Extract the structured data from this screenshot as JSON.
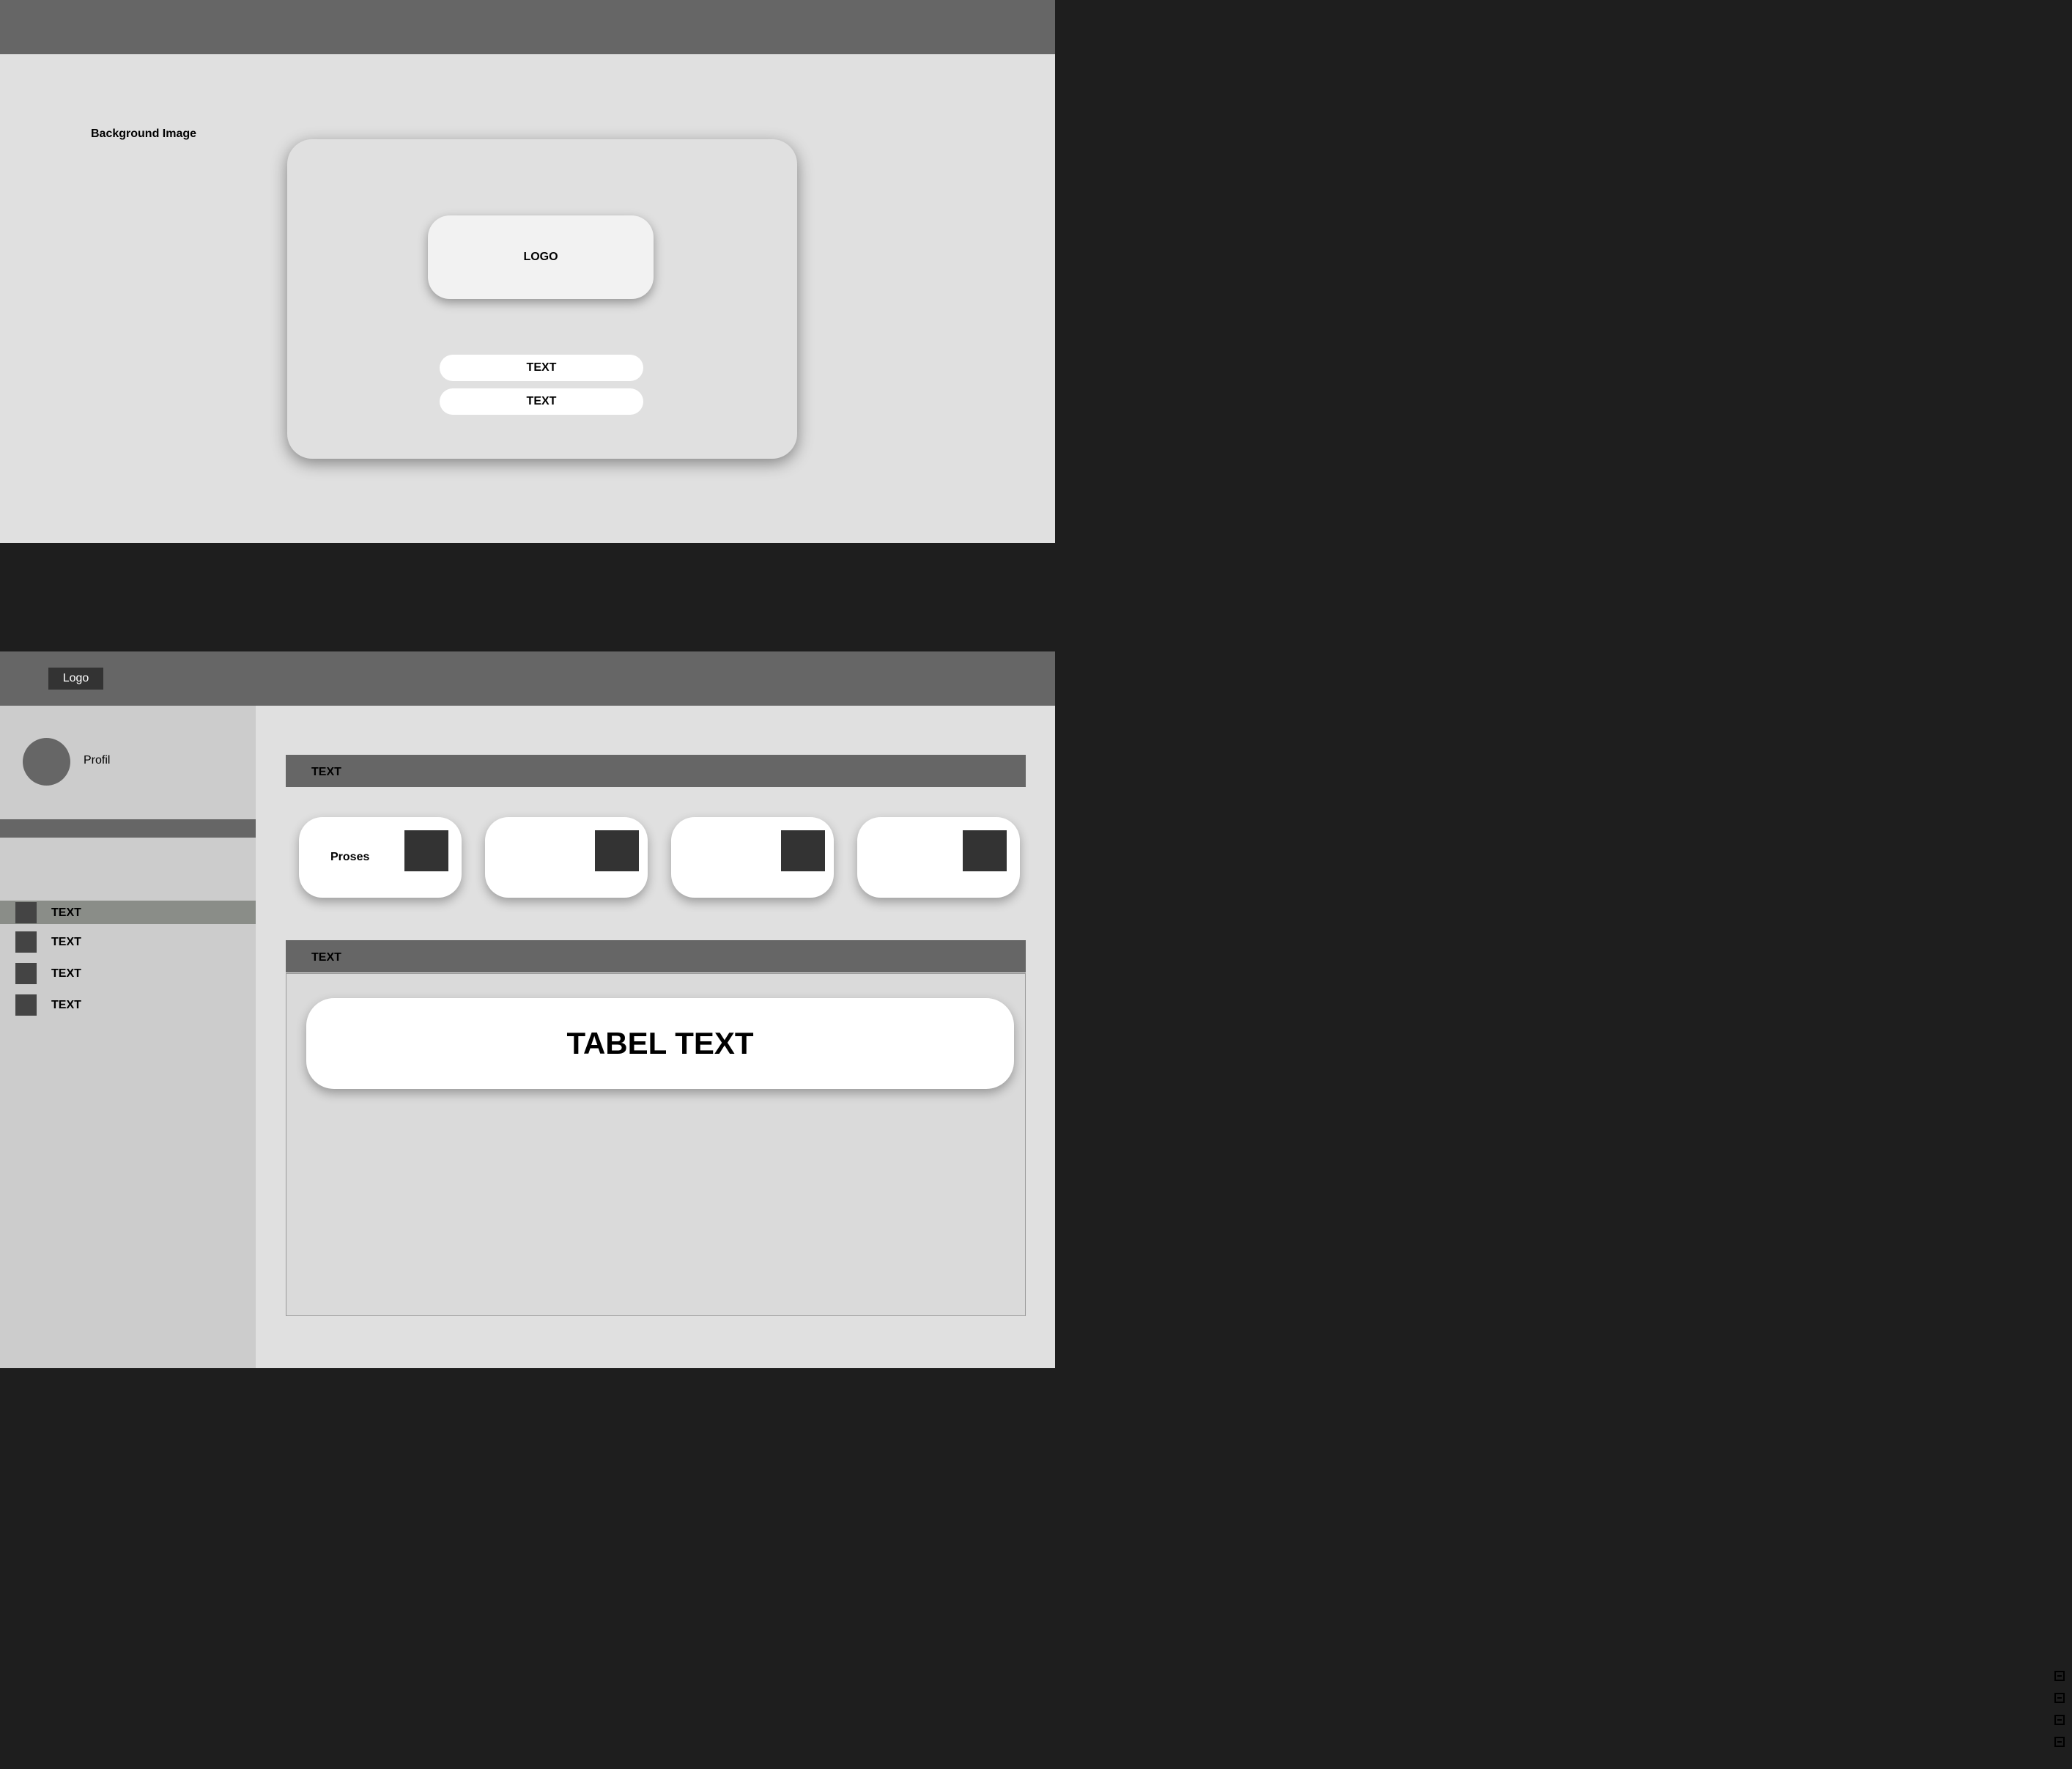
{
  "login": {
    "background_label": "Background Image",
    "logo_label": "LOGO",
    "fields": [
      "TEXT",
      "TEXT"
    ]
  },
  "dashboard": {
    "logo_label": "Logo",
    "profile_name": "Profil",
    "nav_items": [
      {
        "label": "TEXT",
        "active": true
      },
      {
        "label": "TEXT",
        "active": false
      },
      {
        "label": "TEXT",
        "active": false
      },
      {
        "label": "TEXT",
        "active": false
      }
    ],
    "stats_header": "TEXT",
    "stat_cards": [
      {
        "label": "Proses"
      },
      {
        "label": ""
      },
      {
        "label": ""
      },
      {
        "label": ""
      }
    ],
    "table_header": "TEXT",
    "table_row_text": "TABEL TEXT"
  },
  "colors": {
    "background": "#1e1e1e",
    "topbar": "#666666",
    "canvas": "#e0e0e0",
    "sidebar": "#cccccc",
    "active_nav": "#8a8d88",
    "icon_dark": "#333333"
  }
}
